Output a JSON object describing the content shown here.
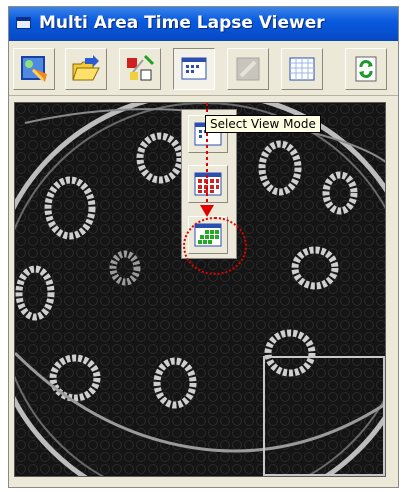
{
  "window": {
    "title": "Multi Area Time Lapse Viewer"
  },
  "toolbar": {
    "buttons": [
      {
        "icon": "open-image-icon"
      },
      {
        "icon": "folder-open-icon"
      },
      {
        "icon": "area-setup-icon"
      },
      {
        "icon": "view-mode-icon",
        "pressed": true
      },
      {
        "icon": "disabled-image-icon",
        "disabled": true
      },
      {
        "icon": "grid-view-icon"
      },
      {
        "icon": "refresh-icon"
      }
    ]
  },
  "tooltip": {
    "text": "Select View Mode"
  },
  "view_mode_menu": {
    "items": [
      {
        "icon": "single-view-icon"
      },
      {
        "icon": "red-grid-view-icon"
      },
      {
        "icon": "green-grid-view-icon",
        "highlighted": true
      }
    ]
  },
  "colors": {
    "title_bar": "#0a5be0",
    "highlight": "#e00000",
    "tooltip_bg": "#ffffe1"
  }
}
